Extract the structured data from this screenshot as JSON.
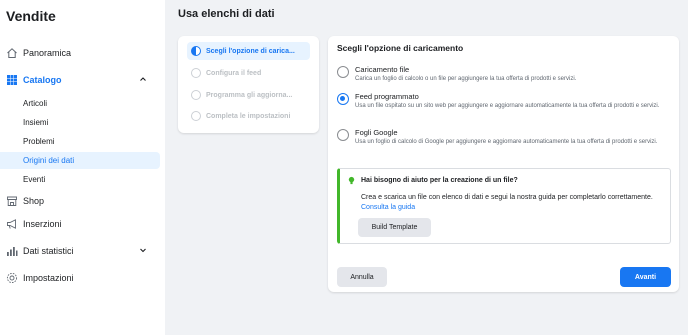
{
  "app": {
    "title": "Vendite"
  },
  "sidebar": {
    "items": [
      {
        "label": "Panoramica",
        "icon": "home-icon"
      },
      {
        "label": "Catalogo",
        "icon": "grid-icon",
        "expanded": true,
        "children": [
          "Articoli",
          "Insiemi",
          "Problemi",
          "Origini dei dati",
          "Eventi"
        ],
        "selected_child": "Origini dei dati"
      },
      {
        "label": "Shop",
        "icon": "shop-icon"
      },
      {
        "label": "Inserzioni",
        "icon": "megaphone-icon"
      },
      {
        "label": "Dati statistici",
        "icon": "bar-chart-icon"
      },
      {
        "label": "Impostazioni",
        "icon": "gear-icon"
      }
    ]
  },
  "page": {
    "title": "Usa elenchi di dati"
  },
  "steps": [
    {
      "label": "Scegli l'opzione di carica...",
      "state": "current"
    },
    {
      "label": "Configura il feed",
      "state": "pending"
    },
    {
      "label": "Programma gli aggiorna...",
      "state": "pending"
    },
    {
      "label": "Completa le impostazioni",
      "state": "pending"
    }
  ],
  "main": {
    "title": "Scegli l'opzione di caricamento",
    "options": [
      {
        "title": "Caricamento file",
        "desc": "Carica un foglio di calcolo o un file per aggiungere la tua offerta di prodotti e servizi.",
        "selected": false
      },
      {
        "title": "Feed programmato",
        "desc": "Usa un file ospitato su un sito web per aggiungere e aggiornare automaticamente la tua offerta di prodotti e servizi.",
        "selected": true
      },
      {
        "title": "Fogli Google",
        "desc": "Usa un foglio di calcolo di Google per aggiungere e aggiornare automaticamente la tua offerta di prodotti e servizi.",
        "selected": false
      }
    ],
    "help": {
      "title": "Hai bisogno di aiuto per la creazione di un file?",
      "text": "Crea e scarica un file con elenco di dati e segui la nostra guida per completarlo correttamente.",
      "link": "Consulta la guida",
      "button": "Build Template"
    },
    "cancel": "Annulla",
    "next": "Avanti"
  },
  "colors": {
    "accent": "#1877f2",
    "help_border": "#42b72a"
  }
}
